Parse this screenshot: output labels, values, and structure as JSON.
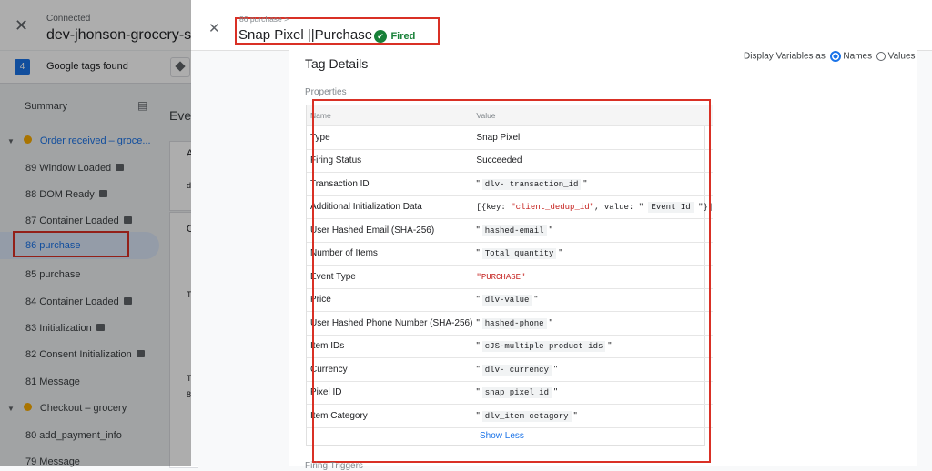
{
  "sidebar": {
    "status": "Connected",
    "container_name": "dev-jhonson-grocery-st",
    "tags_found_count": "4",
    "tags_found_label": "Google tags found",
    "summary_label": "Summary",
    "events": [
      {
        "label": "Order received – groce...",
        "group": true
      },
      {
        "label": "89 Window Loaded",
        "badge": true
      },
      {
        "label": "88 DOM Ready",
        "badge": true
      },
      {
        "label": "87 Container Loaded",
        "badge": true
      },
      {
        "label": "86 purchase",
        "selected": true
      },
      {
        "label": "85 purchase"
      },
      {
        "label": "84 Container Loaded",
        "badge": true
      },
      {
        "label": "83 Initialization",
        "badge": true
      },
      {
        "label": "82 Consent Initialization",
        "badge": true
      },
      {
        "label": "81 Message"
      },
      {
        "label": "Checkout – grocery",
        "group": true
      },
      {
        "label": "80 add_payment_info"
      },
      {
        "label": "79 Message"
      }
    ]
  },
  "background_page": {
    "eve": "Eve",
    "a": "A",
    "d": "d",
    "c": "C",
    "t1": "T",
    "t2": "T",
    "eight": "8"
  },
  "panel": {
    "breadcrumb": "86 purchase >",
    "title": "Snap Pixel ||Purchase",
    "status": "Fired",
    "section_title": "Tag Details",
    "display_vars_label": "Display Variables as",
    "names_label": "Names",
    "values_label": "Values",
    "properties_label": "Properties",
    "table_header": {
      "name": "Name",
      "value": "Value"
    },
    "rows": [
      {
        "name": "Type",
        "value": "Snap Pixel"
      },
      {
        "name": "Firing Status",
        "value": "Succeeded"
      },
      {
        "name": "Transaction ID",
        "var": "dlv- transaction_id"
      },
      {
        "name": "Additional Initialization Data",
        "prefix": "[{key: ",
        "key_str": "\"client_dedup_id\"",
        "mid": ", value: ",
        "var": "Event Id",
        "suffix": "}]"
      },
      {
        "name": "User Hashed Email (SHA-256)",
        "var": "hashed-email"
      },
      {
        "name": "Number of Items",
        "var": "Total quantity"
      },
      {
        "name": "Event Type",
        "string": "\"PURCHASE\""
      },
      {
        "name": "Price",
        "var": "dlv-value"
      },
      {
        "name": "User Hashed Phone Number (SHA-256)",
        "var": "hashed-phone"
      },
      {
        "name": "Item IDs",
        "var": "cJS-multiple product ids"
      },
      {
        "name": "Currency",
        "var": "dlv- currency"
      },
      {
        "name": "Pixel ID",
        "var": "snap pixel id"
      },
      {
        "name": "Item Category",
        "var": "dlv_item cetagory"
      }
    ],
    "show_less_label": "Show Less",
    "firing_triggers_label": "Firing Triggers"
  },
  "colors": {
    "fired_green": "#188038",
    "link_blue": "#1a73e8",
    "highlight_red": "#d93025"
  }
}
